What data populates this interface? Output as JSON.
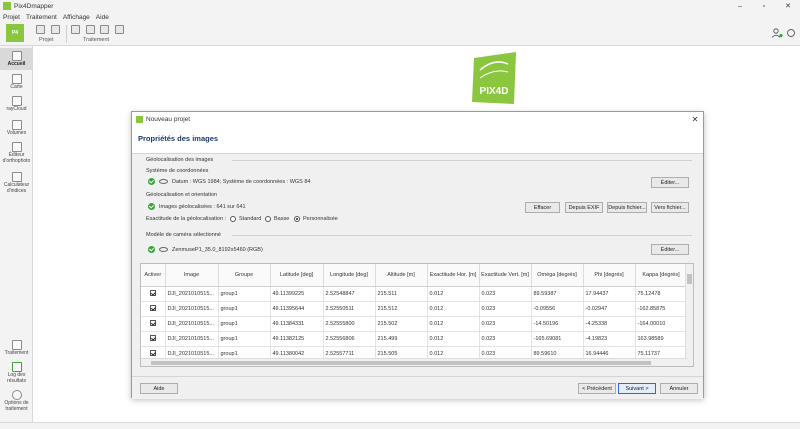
{
  "window": {
    "title": "Pix4Dmapper",
    "logo_text": "PIX4D"
  },
  "menu": [
    "Projet",
    "Traitement",
    "Affichage",
    "Aide"
  ],
  "toolbar": {
    "group_projet": "Projet",
    "group_traitement": "Traitement"
  },
  "sidebar": {
    "items": [
      {
        "label": "Accueil",
        "icon": "home-icon"
      },
      {
        "label": "Carte",
        "icon": "map-icon"
      },
      {
        "label": "rayCloud",
        "icon": "raycloud-icon"
      },
      {
        "label": "Volumes",
        "icon": "volumes-icon"
      },
      {
        "label": "Éditeur d'orthophoto",
        "icon": "ortho-editor-icon"
      },
      {
        "label": "Calculateur d'indices",
        "icon": "index-calculator-icon"
      }
    ],
    "bottom_items": [
      {
        "label": "Traitement",
        "icon": "processing-icon"
      },
      {
        "label": "Log des résultats",
        "icon": "log-icon"
      },
      {
        "label": "Options de traitement",
        "icon": "gear-icon"
      }
    ]
  },
  "dialog": {
    "title": "Nouveau projet",
    "header": "Propriétés des images",
    "geoloc_group": "Géolocalisation des images",
    "coord_system_label": "Système de coordonnées",
    "coord_system_value": "Datum : WGS 1984; Système de coordonnées : WGS 84",
    "edit_button": "Éditer...",
    "geoloc_orientation_label": "Géolocalisation et orientation",
    "geolocated_images": "Images géolocalisées : 641 sur 641",
    "clear_button": "Effacer",
    "from_exif_button": "Depuis EXIF",
    "from_file_button": "Depuis fichier...",
    "to_file_button": "Vers fichier...",
    "accuracy_label": "Exactitude de la géolocalisation :",
    "accuracy_options": [
      "Standard",
      "Basse",
      "Personnalisée"
    ],
    "accuracy_selected": "Personnalisée",
    "camera_group": "Modèle de caméra sélectionné",
    "camera_value": "ZenmuseP1_35.0_8192x5460 (RGB)",
    "camera_edit_button": "Éditer...",
    "table": {
      "headers": [
        "Activer",
        "Image",
        "Groupe",
        "Latitude [deg]",
        "Longitude [deg]",
        "Altitude [m]",
        "Exactitude Hor. [m]",
        "Exactitude Vert. [m]",
        "Oméga [degrés]",
        "Phi [degrés]",
        "Kappa [degrés]"
      ],
      "rows": [
        [
          "",
          "DJI_2021010515...",
          "group1",
          "49.11399225",
          "2.52548847",
          "215.511",
          "0.012",
          "0.023",
          "89.59387",
          "17.94437",
          "75.12478"
        ],
        [
          "",
          "DJI_2021010515...",
          "group1",
          "49.11395644",
          "2.52550511",
          "215.512",
          "0.012",
          "0.023",
          "-0.09556",
          "-0.02947",
          "-162.85875"
        ],
        [
          "",
          "DJI_2021010515...",
          "group1",
          "49.11384331",
          "2.52555800",
          "215.502",
          "0.012",
          "0.023",
          "-14.50196",
          "-4.25338",
          "-164.00010"
        ],
        [
          "",
          "DJI_2021010515...",
          "group1",
          "49.11382125",
          "2.52556806",
          "215.499",
          "0.012",
          "0.023",
          "-165.69081",
          "-4.19823",
          "163.98589"
        ],
        [
          "",
          "DJI_2021010515...",
          "group1",
          "49.11380042",
          "2.52557711",
          "215.505",
          "0.012",
          "0.023",
          "89.59610",
          "16.94446",
          "75.11737"
        ]
      ]
    },
    "help_button": "Aide",
    "previous_button": "< Précédent",
    "next_button": "Suivant >",
    "cancel_button": "Annuler"
  }
}
